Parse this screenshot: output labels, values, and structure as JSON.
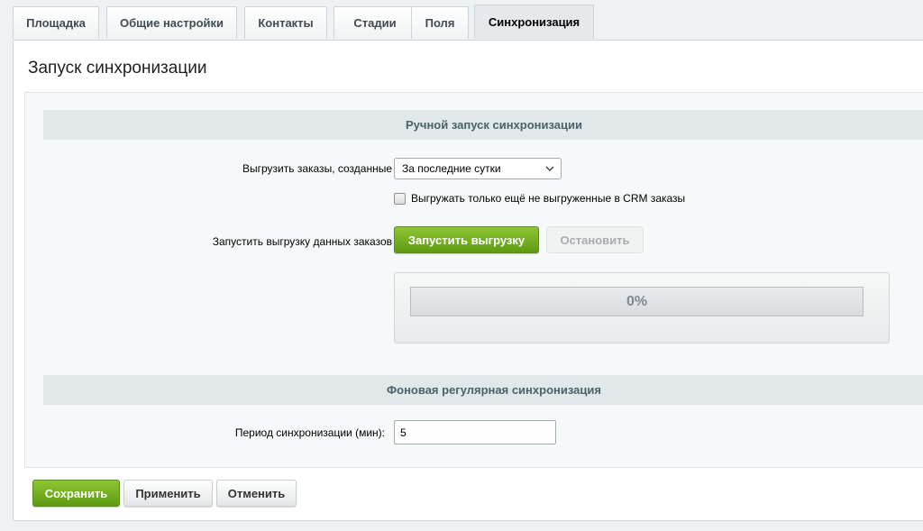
{
  "tabs": [
    {
      "label": "Площадка"
    },
    {
      "label": "Общие настройки"
    },
    {
      "label": "Контакты"
    },
    {
      "label": "Стадии"
    },
    {
      "label": "Поля"
    },
    {
      "label": "Синхронизация",
      "active": true
    }
  ],
  "page_title": "Запуск синхронизации",
  "manual": {
    "header": "Ручной запуск синхронизации",
    "orders_label": "Выгрузить заказы, созданные",
    "orders_period_selected": "За последние сутки",
    "only_new_label": "Выгружать только ещё не выгруженные в CRM заказы",
    "only_new_checked": false,
    "run_label": "Запустить выгрузку данных заказов",
    "start_button": "Запустить выгрузку",
    "stop_button": "Остановить",
    "progress_text": "0%",
    "progress_value": 0
  },
  "background": {
    "header": "Фоновая регулярная синхронизация",
    "period_label": "Период синхронизации (мин):",
    "period_value": "5"
  },
  "footer": {
    "save": "Сохранить",
    "apply": "Применить",
    "cancel": "Отменить"
  },
  "colors": {
    "accent_green": "#6ba81f",
    "section_header_bg": "#e0e8ea"
  }
}
